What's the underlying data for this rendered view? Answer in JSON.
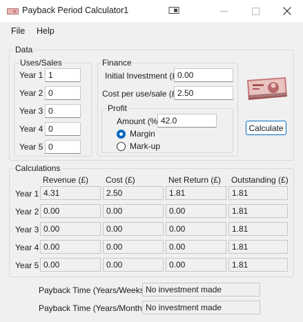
{
  "window": {
    "title": "Payback Period Calculator1",
    "controls": {
      "minimize": "—",
      "maximize": "☐",
      "close": "✕"
    }
  },
  "menu": [
    "File",
    "Help"
  ],
  "data_group": {
    "legend": "Data",
    "uses_sales": {
      "legend": "Uses/Sales",
      "rows": [
        {
          "label": "Year 1",
          "value": "1"
        },
        {
          "label": "Year 2",
          "value": "0"
        },
        {
          "label": "Year 3",
          "value": "0"
        },
        {
          "label": "Year 4",
          "value": "0"
        },
        {
          "label": "Year 5",
          "value": "0"
        }
      ]
    },
    "finance": {
      "legend": "Finance",
      "initial_investment_label": "Initial Investment (£)",
      "initial_investment_value": "0.00",
      "cost_per_use_label": "Cost per use/sale (£)",
      "cost_per_use_value": "2.50",
      "profit": {
        "legend": "Profit",
        "amount_label": "Amount (%)",
        "amount_value": "42.0",
        "margin_label": "Margin",
        "markup_label": "Mark-up",
        "selected": "Margin"
      }
    },
    "calculate_label": "Calculate"
  },
  "calculations": {
    "legend": "Calculations",
    "columns": [
      "Revenue (£)",
      "Cost (£)",
      "Net Return (£)",
      "Outstanding (£)"
    ],
    "rows": [
      {
        "label": "Year 1",
        "cells": [
          "4.31",
          "2.50",
          "1.81",
          "1.81"
        ]
      },
      {
        "label": "Year 2",
        "cells": [
          "0.00",
          "0.00",
          "0.00",
          "1.81"
        ]
      },
      {
        "label": "Year 3",
        "cells": [
          "0.00",
          "0.00",
          "0.00",
          "1.81"
        ]
      },
      {
        "label": "Year 4",
        "cells": [
          "0.00",
          "0.00",
          "0.00",
          "1.81"
        ]
      },
      {
        "label": "Year 5",
        "cells": [
          "0.00",
          "0.00",
          "0.00",
          "1.81"
        ]
      }
    ]
  },
  "payback": {
    "weeks_label": "Payback Time (Years/Weeks)",
    "weeks_value": "No investment made",
    "months_label": "Payback Time (Years/Months)",
    "months_value": "No investment made"
  },
  "colors": {
    "accent": "#0067c0",
    "title_bg": "#ffffff",
    "window_bg": "#f0f0f0"
  }
}
